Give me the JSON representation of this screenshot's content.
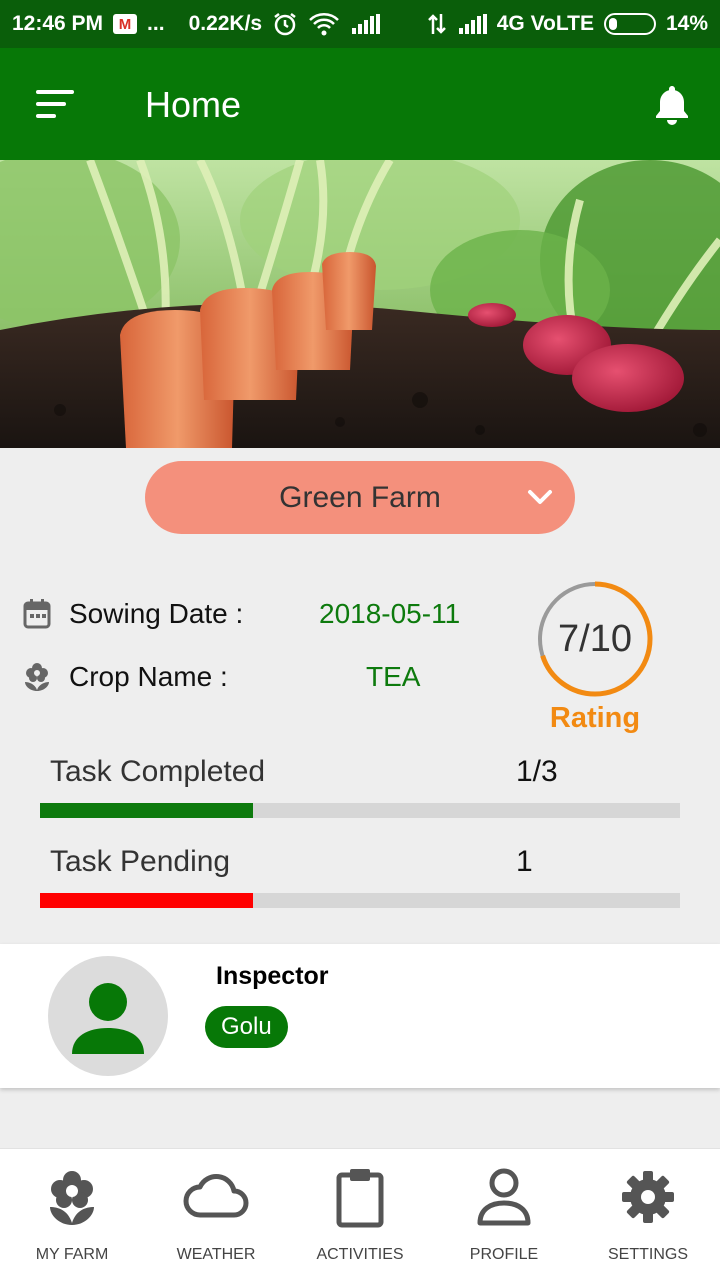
{
  "status_bar": {
    "time": "12:46 PM",
    "dots": "...",
    "speed": "0.22K/s",
    "network": "4G VoLTE",
    "battery": "14%"
  },
  "app_bar": {
    "title": "Home",
    "menu_icon": "sort-menu-icon",
    "notification_icon": "bell-icon"
  },
  "farm_selector": {
    "selected": "Green Farm"
  },
  "crop_info": {
    "sowing_date_label": "Sowing Date :",
    "sowing_date_value": "2018-05-11",
    "crop_name_label": "Crop Name :",
    "crop_name_value": "TEA"
  },
  "rating": {
    "value": "7/10",
    "label": "Rating",
    "fraction": 0.7
  },
  "tasks": {
    "completed_label": "Task Completed",
    "completed_value": "1/3",
    "completed_fraction": 0.333,
    "pending_label": "Task Pending",
    "pending_value": "1",
    "pending_fraction": 0.333
  },
  "inspector": {
    "heading": "Inspector",
    "name": "Golu"
  },
  "bottom_nav": [
    {
      "label": "MY FARM",
      "icon": "flower-icon"
    },
    {
      "label": "WEATHER",
      "icon": "cloud-icon"
    },
    {
      "label": "ACTIVITIES",
      "icon": "clipboard-icon"
    },
    {
      "label": "PROFILE",
      "icon": "person-icon"
    },
    {
      "label": "SETTINGS",
      "icon": "gear-icon"
    }
  ],
  "colors": {
    "primary": "#077807",
    "status_bar": "#0a5e0a",
    "farm_selector": "#f4907c",
    "rating_accent": "#f28a12",
    "completed_bar": "#0d7a0d",
    "pending_bar": "#ff0000",
    "bar_track": "#d6d6d6"
  }
}
